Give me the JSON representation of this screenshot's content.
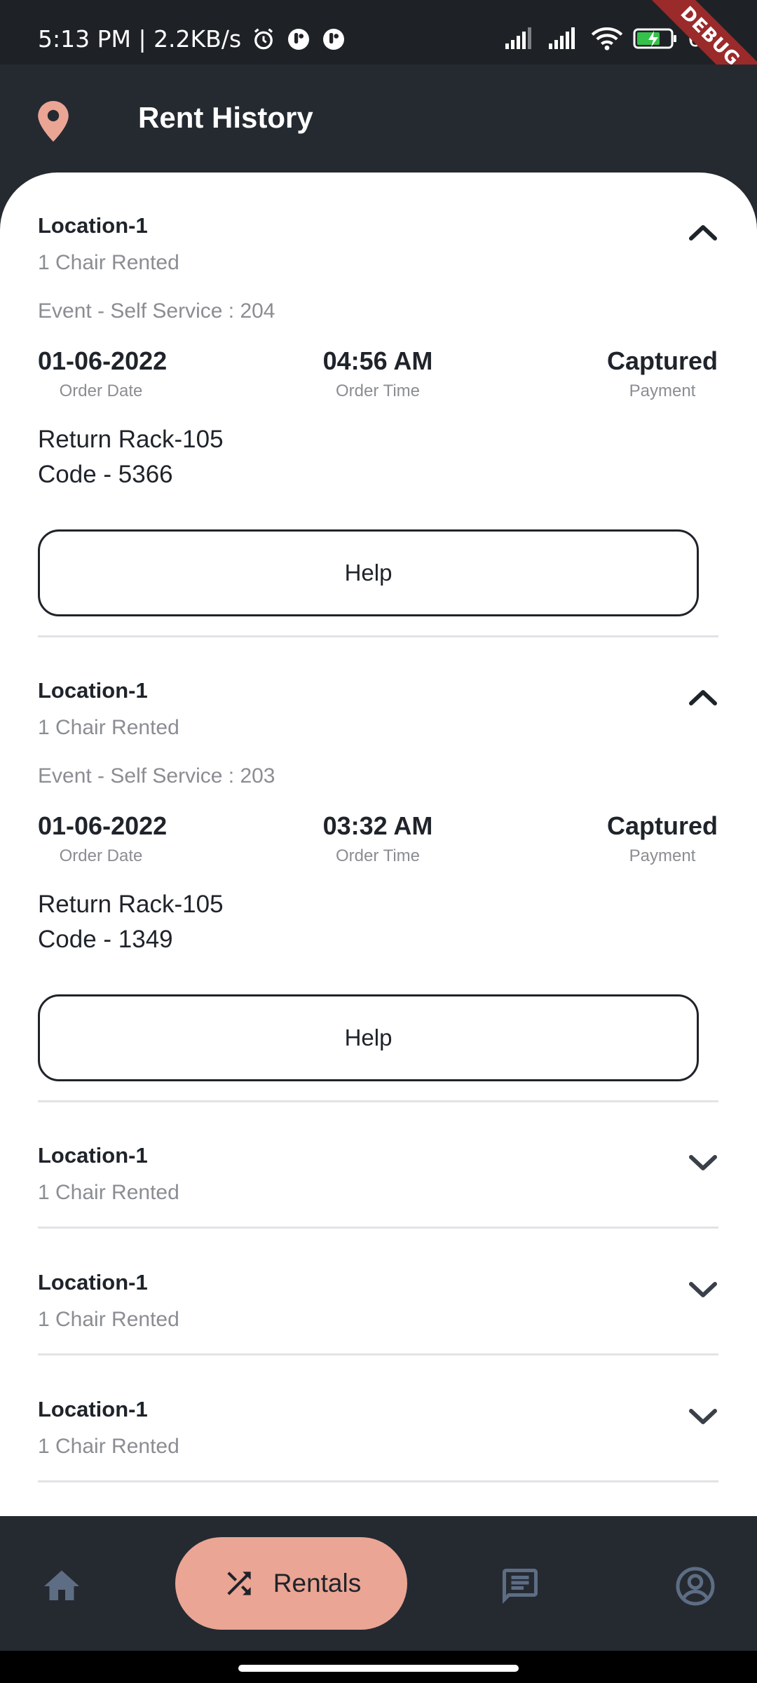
{
  "status_bar": {
    "time_speed": "5:13 PM | 2.2KB/s",
    "battery_text": "66",
    "debug_label": "DEBUG",
    "icons": [
      "alarm-icon",
      "app-notification-icon",
      "app-notification-icon",
      "signal-icon",
      "signal-icon",
      "wifi-icon",
      "battery-charging-icon"
    ]
  },
  "app_bar": {
    "title": "Rent History",
    "icon": "location-pin-icon",
    "accent_color": "#eaa594"
  },
  "rentals": [
    {
      "location": "Location-1",
      "rented": "1 Chair Rented",
      "expanded": true,
      "event": "Event - Self Service : 204",
      "order_date": "01-06-2022",
      "order_date_label": "Order Date",
      "order_time": "04:56 AM",
      "order_time_label": "Order Time",
      "payment": "Captured",
      "payment_label": "Payment",
      "return_rack": "Return Rack-105",
      "code": "Code - 5366",
      "help_label": "Help"
    },
    {
      "location": "Location-1",
      "rented": "1 Chair Rented",
      "expanded": true,
      "event": "Event - Self Service : 203",
      "order_date": "01-06-2022",
      "order_date_label": "Order Date",
      "order_time": "03:32 AM",
      "order_time_label": "Order Time",
      "payment": "Captured",
      "payment_label": "Payment",
      "return_rack": "Return Rack-105",
      "code": "Code - 1349",
      "help_label": "Help"
    },
    {
      "location": "Location-1",
      "rented": "1 Chair Rented",
      "expanded": false
    },
    {
      "location": "Location-1",
      "rented": "1 Chair Rented",
      "expanded": false
    },
    {
      "location": "Location-1",
      "rented": "1 Chair Rented",
      "expanded": false
    }
  ],
  "bottom_nav": {
    "items": [
      {
        "icon": "home-icon",
        "active": false
      },
      {
        "icon": "shuffle-icon",
        "label": "Rentals",
        "active": true
      },
      {
        "icon": "chat-icon",
        "active": false
      },
      {
        "icon": "account-icon",
        "active": false
      }
    ]
  }
}
